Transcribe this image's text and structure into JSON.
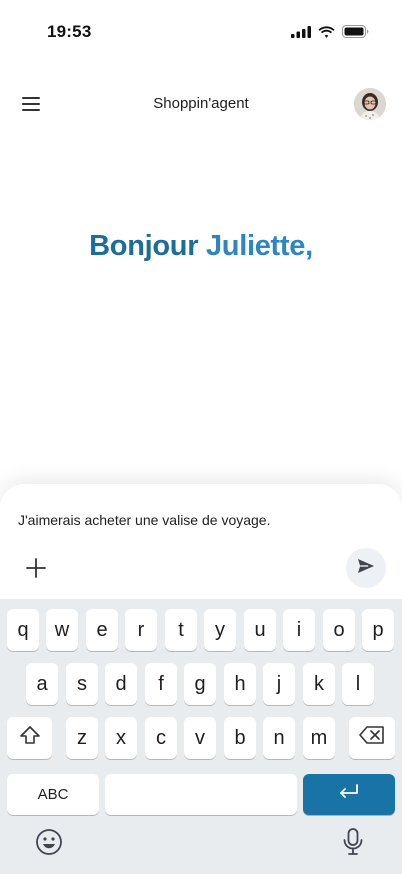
{
  "status_bar": {
    "time": "19:53",
    "icons": [
      "signal-icon",
      "wifi-icon",
      "battery-icon"
    ]
  },
  "header": {
    "title": "Shoppin'agent",
    "menu_icon": "hamburger-menu-icon",
    "avatar": "user-avatar"
  },
  "greeting": {
    "hello": "Bonjour",
    "name": "Juliette,"
  },
  "composer": {
    "message": "J'aimerais acheter une valise de voyage.",
    "plus_icon": "plus-icon",
    "send_icon": "send-icon"
  },
  "keyboard": {
    "row1": [
      "q",
      "w",
      "e",
      "r",
      "t",
      "y",
      "u",
      "i",
      "o",
      "p"
    ],
    "row2": [
      "a",
      "s",
      "d",
      "f",
      "g",
      "h",
      "j",
      "k",
      "l"
    ],
    "row3": [
      "z",
      "x",
      "c",
      "v",
      "b",
      "n",
      "m"
    ],
    "abc_label": "ABC",
    "icons": [
      "shift-icon",
      "backspace-icon",
      "return-icon",
      "emoji-icon",
      "microphone-icon"
    ]
  },
  "colors": {
    "brand_dark": "#1b6d9c",
    "brand_light": "#2b86c3",
    "enter_key": "#1873a6",
    "keyboard_bg": "#e9ecef"
  }
}
